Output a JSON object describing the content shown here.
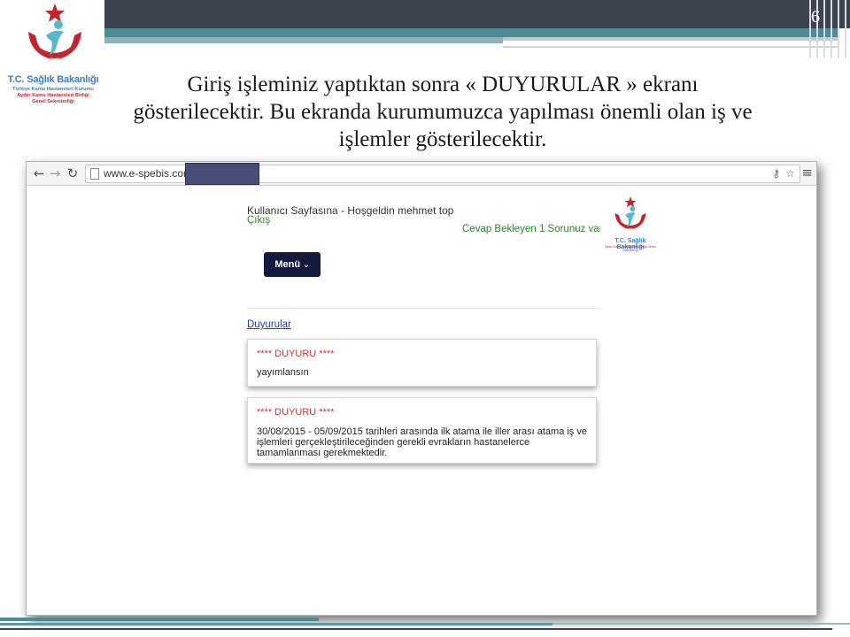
{
  "slide": {
    "page_number": "6",
    "caption_lines": [
      "Giriş işleminiz yaptıktan sonra « DUYURULAR » ekranı",
      "gösterilecektir. Bu ekranda kurumumuzca yapılması önemli olan iş ve",
      "işlemler gösterilecektir."
    ],
    "logo": {
      "title": "T.C. Sağlık Bakanlığı",
      "line1": "Türkiye Kamu Hastaneleri Kurumu",
      "line2": "Aydın Kamu Hastaneleri Birliği",
      "line3": "Genel Sekreterliği"
    }
  },
  "browser": {
    "address": "www.e-spebis.com/",
    "icons": [
      "back-icon",
      "forward-icon",
      "reload-icon",
      "page-icon",
      "key-icon",
      "star-icon",
      "menu-icon"
    ]
  },
  "page": {
    "welcome": "Kullanıcı Sayfasına - Hoşgeldin mehmet top",
    "logout": "Çıkış",
    "pending": "Cevap Bekleyen 1 Sorunuz var",
    "menu_label": "Menü",
    "announcements_link": "Duyurular",
    "announcements": [
      {
        "header": "**** DUYURU ****",
        "body": "yayımlansın"
      },
      {
        "header": "**** DUYURU ****",
        "body": "30/08/2015 - 05/09/2015 tarihleri arasında ilk atama ile iller arası atama iş ve işlemleri gerçekleştirileceğinden gerekli evrakların hastanelerce tamamlanması gerekmektedir."
      }
    ],
    "small_logo": {
      "title": "T.C. Sağlık Bakanlığı",
      "sub": "Aydın Kamu Hastaneleri Birliği Genel Sekreterliği"
    }
  },
  "colors": {
    "header_band": "#3e4350",
    "teal": "#4f8a97",
    "menu_button": "#141a3f",
    "alert_red": "#d43232",
    "link_blue": "#1c3fa6",
    "status_green": "#2a8a2a"
  }
}
